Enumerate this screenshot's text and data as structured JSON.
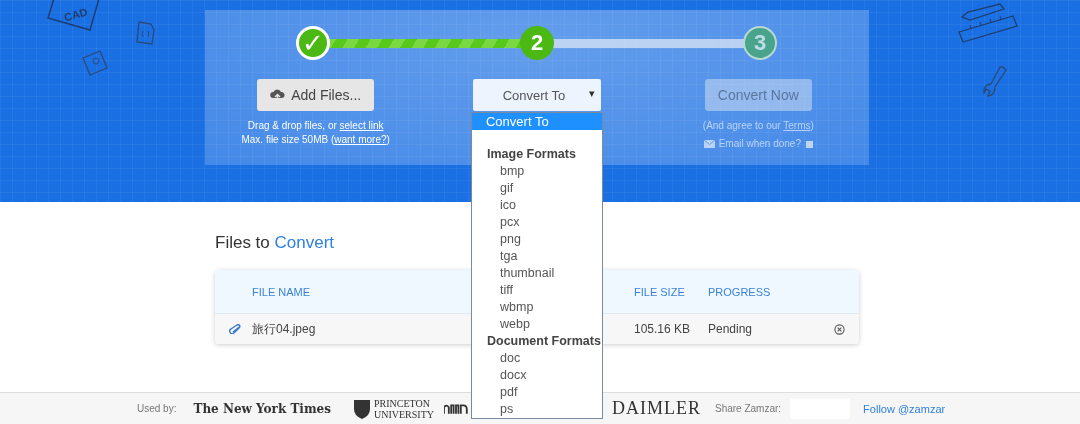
{
  "background_doodles": {
    "cad_label": "CAD"
  },
  "steps": [
    {
      "label": "✓",
      "done": true,
      "current": false
    },
    {
      "label": "2",
      "done": false,
      "current": true
    },
    {
      "label": "3",
      "done": false,
      "current": false
    }
  ],
  "add_files": {
    "label": "Add Files...",
    "hint_prefix": "Drag & drop files, or",
    "hint_link": "select link",
    "size_prefix": "Max. file size 50MB (",
    "size_link": "want more?",
    "size_suffix": ")"
  },
  "convert_select": {
    "value": "Convert To",
    "caret": "▾"
  },
  "dropdown": {
    "options": [
      {
        "label": "Convert To",
        "selected": true
      }
    ],
    "groups": [
      {
        "label": "Image Formats",
        "options": [
          {
            "label": "bmp",
            "selected": false
          },
          {
            "label": "gif",
            "selected": false
          },
          {
            "label": "ico",
            "selected": false
          },
          {
            "label": "pcx",
            "selected": false
          },
          {
            "label": "png",
            "selected": false
          },
          {
            "label": "tga",
            "selected": false
          },
          {
            "label": "thumbnail",
            "selected": false
          },
          {
            "label": "tiff",
            "selected": false
          },
          {
            "label": "wbmp",
            "selected": false
          },
          {
            "label": "webp",
            "selected": false
          }
        ]
      },
      {
        "label": "Document Formats",
        "options": [
          {
            "label": "doc",
            "selected": false
          },
          {
            "label": "docx",
            "selected": false
          },
          {
            "label": "pdf",
            "selected": false
          },
          {
            "label": "ps",
            "selected": false
          }
        ]
      }
    ]
  },
  "convert_now": {
    "label": "Convert Now",
    "disabled": true,
    "terms_prefix": "(And agree to our ",
    "terms_link": "Terms",
    "terms_suffix": ")",
    "email_label": "Email when done?",
    "email_checked": false
  },
  "files": {
    "title_plain": "Files to",
    "title_accent": "Convert",
    "columns": [
      "FILE NAME",
      "FILE SIZE",
      "PROGRESS"
    ],
    "rows": [
      {
        "name": "旅行04.jpeg",
        "size": "105.16 KB",
        "progress": "Pending"
      }
    ]
  },
  "footer": {
    "used_by": "Used by:",
    "logos": [
      "The New York Times",
      "PRINCETON",
      "UNIVERSITY",
      "DAIMLER"
    ],
    "share": "Share Zamzar:",
    "follow": "Follow @zamzar"
  }
}
